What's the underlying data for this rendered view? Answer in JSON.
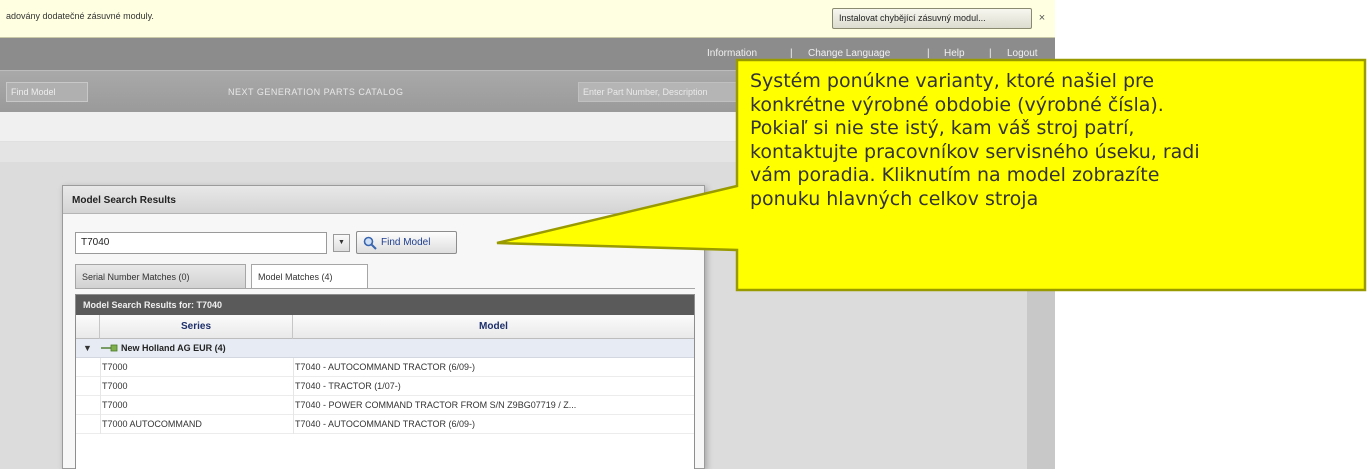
{
  "infobar": {
    "message": "adovány dodatečné zásuvné moduly.",
    "install_button": "Instalovat chybějící zásuvný modul...",
    "close": "×"
  },
  "topnav": {
    "links": [
      "Information",
      "|",
      "Change Language",
      "|",
      "Help",
      "|",
      "Logout"
    ]
  },
  "catalog_bar": {
    "find_model": "Find Model",
    "title": "NEXT GENERATION PARTS CATALOG",
    "search_placeholder": "Enter Part Number, Description"
  },
  "dialog": {
    "title": "Model Search Results",
    "close": "×",
    "model_value": "T7040",
    "dropdown_glyph": "▼",
    "find_button": "Find Model",
    "tabs": [
      "Serial Number Matches (0)",
      "Model Matches (4)"
    ],
    "results_title": "Model Search Results for:  T7040",
    "columns": [
      "Series",
      "Model"
    ],
    "group": {
      "arrow": "▼",
      "label": "New Holland AG EUR (4)"
    },
    "rows": [
      {
        "series": "T7000",
        "model": "T7040 - AUTOCOMMAND TRACTOR (6/09-)"
      },
      {
        "series": "T7000",
        "model": "T7040 - TRACTOR (1/07-)"
      },
      {
        "series": "T7000",
        "model": "T7040 - POWER COMMAND TRACTOR FROM S/N Z9BG07719 / Z..."
      },
      {
        "series": "T7000 AUTOCOMMAND",
        "model": "T7040 - AUTOCOMMAND TRACTOR (6/09-)"
      }
    ]
  },
  "callout": {
    "lines": [
      "Systém ponúkne varianty, ktoré našiel pre",
      "konkrétne výrobné obdobie (výrobné čísla).",
      "Pokiaľ si nie ste istý, kam váš stroj patrí,",
      "kontaktujte pracovníkov servisného úseku, radi",
      "vám poradia. Kliknutím na model zobrazíte",
      "ponuku hlavných celkov stroja"
    ],
    "fill_color": "#ffff00",
    "border_color": "#999900"
  }
}
